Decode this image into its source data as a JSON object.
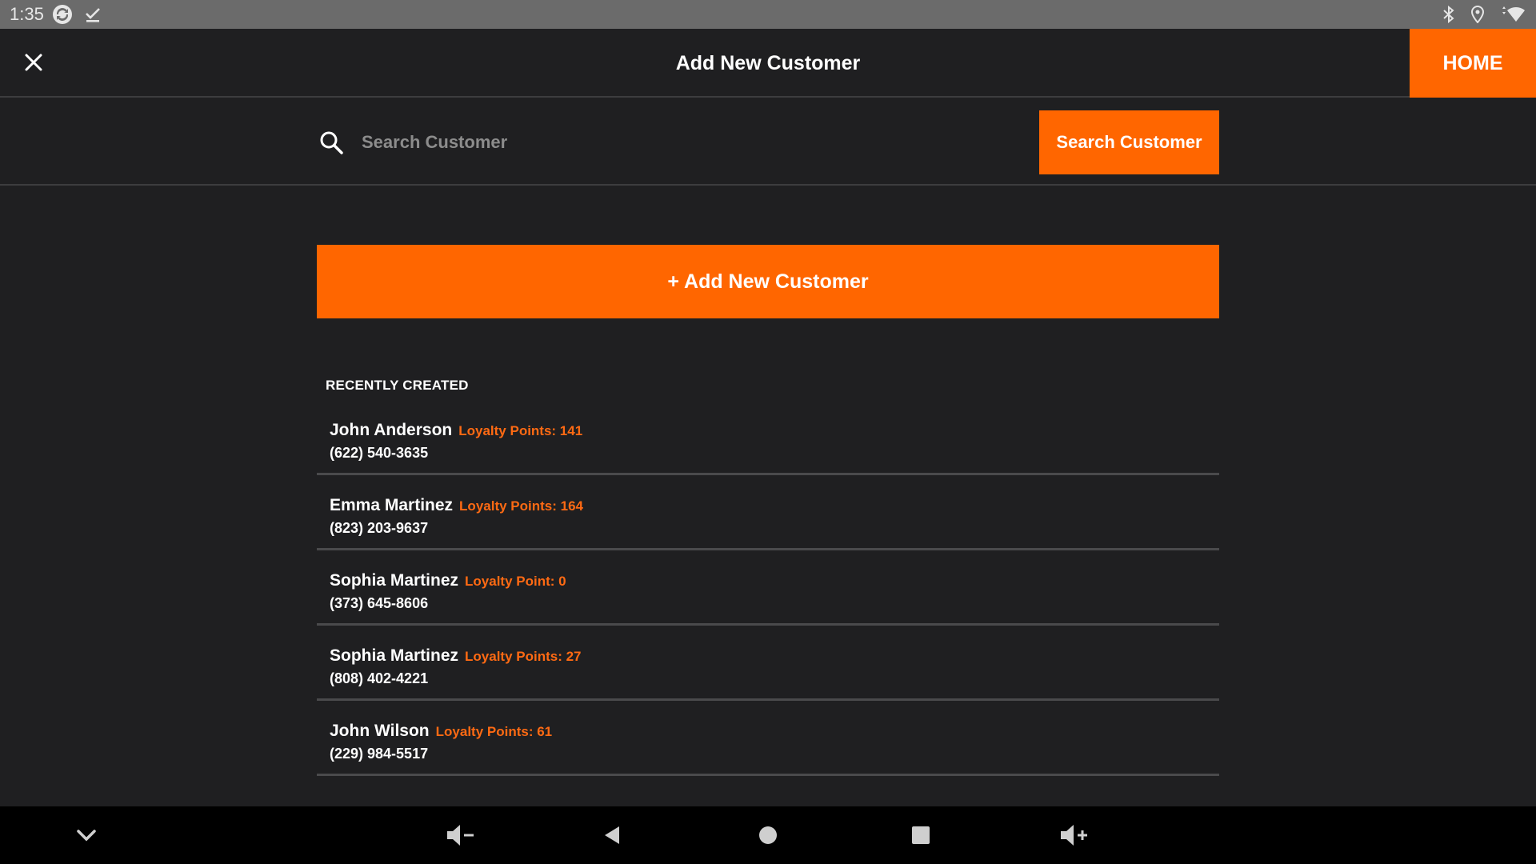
{
  "status_bar": {
    "time": "1:35",
    "left_icons": [
      "sync-icon",
      "download-done-icon"
    ],
    "right_icons": [
      "bluetooth-icon",
      "location-icon",
      "wifi-icon"
    ]
  },
  "header": {
    "title": "Add New Customer",
    "home_label": "HOME",
    "close_icon": "close-icon"
  },
  "search": {
    "placeholder": "Search Customer",
    "value": "",
    "button_label": "Search Customer"
  },
  "add_customer": {
    "label": "+ Add New Customer"
  },
  "recent": {
    "heading": "RECENTLY CREATED",
    "customers": [
      {
        "name": "John Anderson",
        "points": "Loyalty Points: 141",
        "phone": "(622) 540-3635"
      },
      {
        "name": "Emma Martinez",
        "points": "Loyalty Points: 164",
        "phone": "(823) 203-9637"
      },
      {
        "name": "Sophia Martinez",
        "points": "Loyalty Point: 0",
        "phone": "(373) 645-8606"
      },
      {
        "name": "Sophia Martinez",
        "points": "Loyalty Points: 27",
        "phone": "(808) 402-4221"
      },
      {
        "name": "John Wilson",
        "points": "Loyalty Points: 61",
        "phone": "(229) 984-5517"
      }
    ]
  },
  "nav_bar": {
    "icons": [
      "chevron-down-icon",
      "volume-down-icon",
      "back-icon",
      "home-icon",
      "recents-icon",
      "volume-up-icon"
    ]
  },
  "colors": {
    "accent": "#ff6600",
    "background": "#1f1f21",
    "status_bar": "#6b6b6b",
    "divider": "#4a4a4c",
    "nav_bar": "#000000"
  }
}
